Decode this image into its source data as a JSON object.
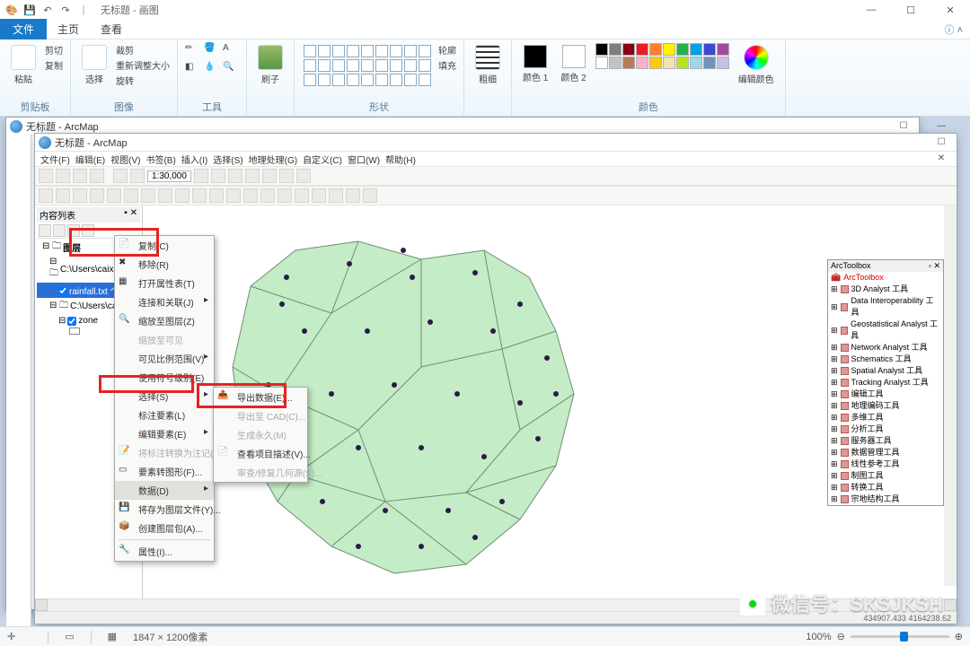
{
  "paint": {
    "title": "无标题 - 画图",
    "tabs": {
      "file": "文件",
      "home": "主页",
      "view": "查看"
    },
    "groups": {
      "clipboard": {
        "label": "剪贴板",
        "paste": "粘贴",
        "cut": "剪切",
        "copy": "复制"
      },
      "image": {
        "label": "图像",
        "select": "选择",
        "crop": "裁剪",
        "resize": "重新调整大小",
        "rotate": "旋转"
      },
      "tools": {
        "label": "工具"
      },
      "brush": {
        "label": "刷子"
      },
      "shapes": {
        "label": "形状",
        "outline": "轮廓",
        "fill": "填充"
      },
      "thick": {
        "label": "粗细"
      },
      "colors": {
        "label": "颜色",
        "c1": "颜色 1",
        "c2": "颜色 2",
        "edit": "编辑颜色"
      }
    },
    "palette": [
      "#000",
      "#7f7f7f",
      "#880015",
      "#ed1c24",
      "#ff7f27",
      "#fff200",
      "#22b14c",
      "#00a2e8",
      "#3f48cc",
      "#a349a4",
      "#fff",
      "#c3c3c3",
      "#b97a57",
      "#ffaec9",
      "#ffc90e",
      "#efe4b0",
      "#b5e61d",
      "#99d9ea",
      "#7092be",
      "#c8bfe7"
    ],
    "status": {
      "dims": "1847 × 1200像素",
      "zoom": "100%"
    }
  },
  "arcmap": {
    "title": "无标题 - ArcMap",
    "menu": [
      "文件(F)",
      "编辑(E)",
      "视图(V)",
      "书签(B)",
      "插入(I)",
      "选择(S)",
      "地理处理(G)",
      "自定义(C)",
      "窗口(W)",
      "帮助(H)"
    ],
    "scale": "1:30,000",
    "toc": {
      "hdr": "内容列表",
      "root": "图层",
      "items": [
        "C:\\Users\\caixi\\Deskt...",
        "rainfall.txt 个事件",
        "C:\\Users\\ca",
        "zone"
      ]
    },
    "toolbox": {
      "hdr": "ArcToolbox",
      "root": "ArcToolbox",
      "items": [
        "3D Analyst 工具",
        "Data Interoperability 工具",
        "Geostatistical Analyst 工具",
        "Network Analyst 工具",
        "Schematics 工具",
        "Spatial Analyst 工具",
        "Tracking Analyst 工具",
        "编辑工具",
        "地理编码工具",
        "多维工具",
        "分析工具",
        "服务器工具",
        "数据管理工具",
        "线性参考工具",
        "制图工具",
        "转换工具",
        "宗地结构工具"
      ]
    },
    "ctx": {
      "copy": "复制(C)",
      "remove": "移除(R)",
      "openAttr": "打开属性表(T)",
      "joinRelate": "连接和关联(J)",
      "zoomLayer": "缩放至图层(Z)",
      "zoomVisible": "缩放至可见",
      "visScale": "可见比例范围(V)",
      "useSymLvl": "使用符号级别(E)",
      "selection": "选择(S)",
      "labelFeat": "标注要素(L)",
      "editFeat": "编辑要素(E)",
      "convFeatAnno": "将标注转换为注记(N)...",
      "convSymRep": "要素转图形(F)...",
      "data": "数据(D)",
      "saveLyr": "将存为图层文件(Y)...",
      "createPkg": "创建图层包(A)...",
      "props": "属性(I)..."
    },
    "sub": {
      "export": "导出数据(E)...",
      "exportCAD": "导出至 CAD(C)...",
      "makePerm": "生成永久(M)",
      "viewItemDesc": "查看项目描述(V)...",
      "reviewRepair": "审查/修复几何源(S)..."
    },
    "coords": "434907.433  4164238.62"
  },
  "wm": "微信号：SKSJKSH"
}
